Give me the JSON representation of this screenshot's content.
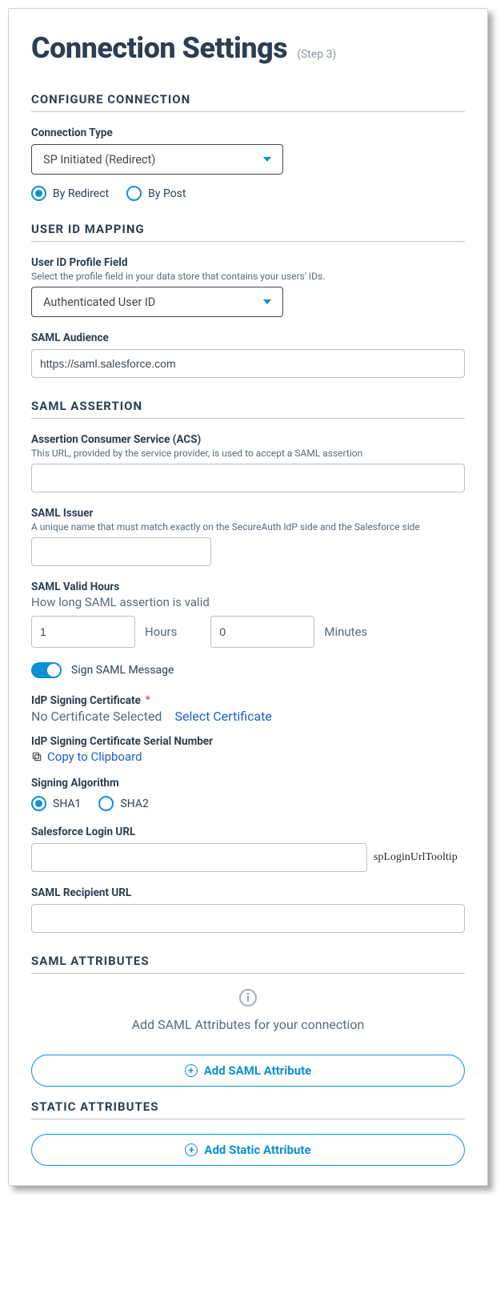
{
  "header": {
    "title": "Connection Settings",
    "step": "(Step 3)"
  },
  "sections": {
    "configure": {
      "title": "CONFIGURE CONNECTION",
      "connection_type_label": "Connection Type",
      "connection_type_value": "SP Initiated (Redirect)",
      "radios": {
        "by_redirect": "By Redirect",
        "by_post": "By Post"
      }
    },
    "mapping": {
      "title": "USER ID MAPPING",
      "profile_field_label": "User ID Profile Field",
      "profile_field_sub": "Select the profile field in your data store that contains your users' IDs.",
      "profile_field_value": "Authenticated User ID",
      "saml_audience_label": "SAML Audience",
      "saml_audience_value": "https://saml.salesforce.com"
    },
    "assertion": {
      "title": "SAML ASSERTION",
      "acs_label": "Assertion Consumer Service (ACS)",
      "acs_sub": "This URL, provided by the service provider, is used to accept a SAML assertion",
      "acs_value": "",
      "issuer_label": "SAML Issuer",
      "issuer_sub": "A unique name that must match exactly on the SecureAuth IdP side and the Salesforce side",
      "issuer_value": "",
      "valid_hours_label": "SAML Valid Hours",
      "valid_hours_sub": "How long SAML assertion is valid",
      "hours_value": "1",
      "hours_unit": "Hours",
      "minutes_value": "0",
      "minutes_unit": "Minutes",
      "sign_message_label": "Sign SAML Message",
      "idp_cert_label": "IdP Signing Certificate",
      "idp_cert_value": "No Certificate Selected",
      "select_cert_link": "Select Certificate",
      "serial_label": "IdP Signing Certificate Serial Number",
      "copy_link": "Copy to Clipboard",
      "algo_label": "Signing Algorithm",
      "algo_sha1": "SHA1",
      "algo_sha2": "SHA2",
      "login_url_label": "Salesforce Login URL",
      "login_url_value": "",
      "login_url_tooltip": "spLoginUrlTooltip",
      "recipient_label": "SAML Recipient URL",
      "recipient_value": ""
    },
    "attributes": {
      "title": "SAML ATTRIBUTES",
      "info_text": "Add SAML Attributes for your connection",
      "add_saml_button": "Add SAML Attribute"
    },
    "static_attrs": {
      "title": "STATIC ATTRIBUTES",
      "add_static_button": "Add Static Attribute"
    }
  }
}
